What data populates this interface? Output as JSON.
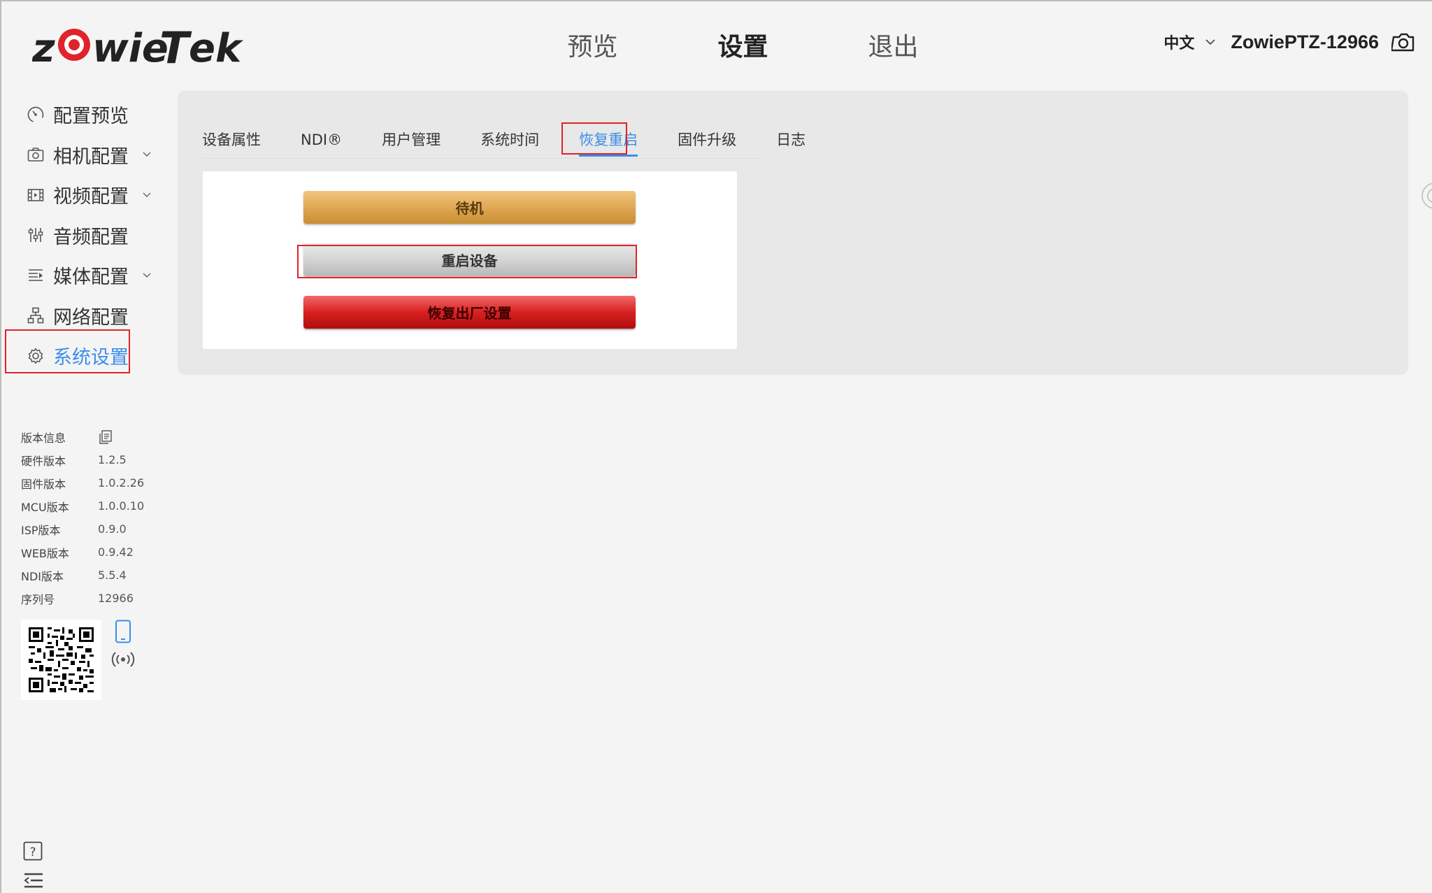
{
  "brand": {
    "logo_text": "zowieTek",
    "accent": "#e0232b"
  },
  "nav": {
    "items": [
      "预览",
      "设置",
      "退出"
    ],
    "active": 1
  },
  "header": {
    "language": "中文",
    "device_name": "ZowiePTZ-12966"
  },
  "sidebar": {
    "items": [
      {
        "label": "配置预览",
        "icon": "gauge-icon",
        "expandable": false
      },
      {
        "label": "相机配置",
        "icon": "camera-icon",
        "expandable": true
      },
      {
        "label": "视频配置",
        "icon": "film-icon",
        "expandable": true
      },
      {
        "label": "音频配置",
        "icon": "audio-sliders-icon",
        "expandable": false
      },
      {
        "label": "媒体配置",
        "icon": "media-icon",
        "expandable": true
      },
      {
        "label": "网络配置",
        "icon": "network-icon",
        "expandable": false
      },
      {
        "label": "系统设置",
        "icon": "gear-icon",
        "expandable": false
      }
    ],
    "active": 6
  },
  "version_info": {
    "title": "版本信息",
    "rows": [
      {
        "key": "硬件版本",
        "value": "1.2.5"
      },
      {
        "key": "固件版本",
        "value": "1.0.2.26"
      },
      {
        "key": "MCU版本",
        "value": "1.0.0.10"
      },
      {
        "key": "ISP版本",
        "value": "0.9.0"
      },
      {
        "key": "WEB版本",
        "value": "0.9.42"
      },
      {
        "key": "NDI版本",
        "value": "5.5.4"
      },
      {
        "key": "序列号",
        "value": "12966"
      }
    ]
  },
  "tabs": {
    "items": [
      "设备属性",
      "NDI®",
      "用户管理",
      "系统时间",
      "恢复重启",
      "固件升级",
      "日志"
    ],
    "active": 4
  },
  "actions": {
    "standby": "待机",
    "reboot": "重启设备",
    "factory_reset": "恢复出厂设置"
  },
  "colors": {
    "active_blue": "#3b8eea",
    "standby_gold": "#e0a853",
    "reboot_gray": "#d4d4d4",
    "factory_red": "#d92020",
    "highlight_red": "#e0232b"
  }
}
